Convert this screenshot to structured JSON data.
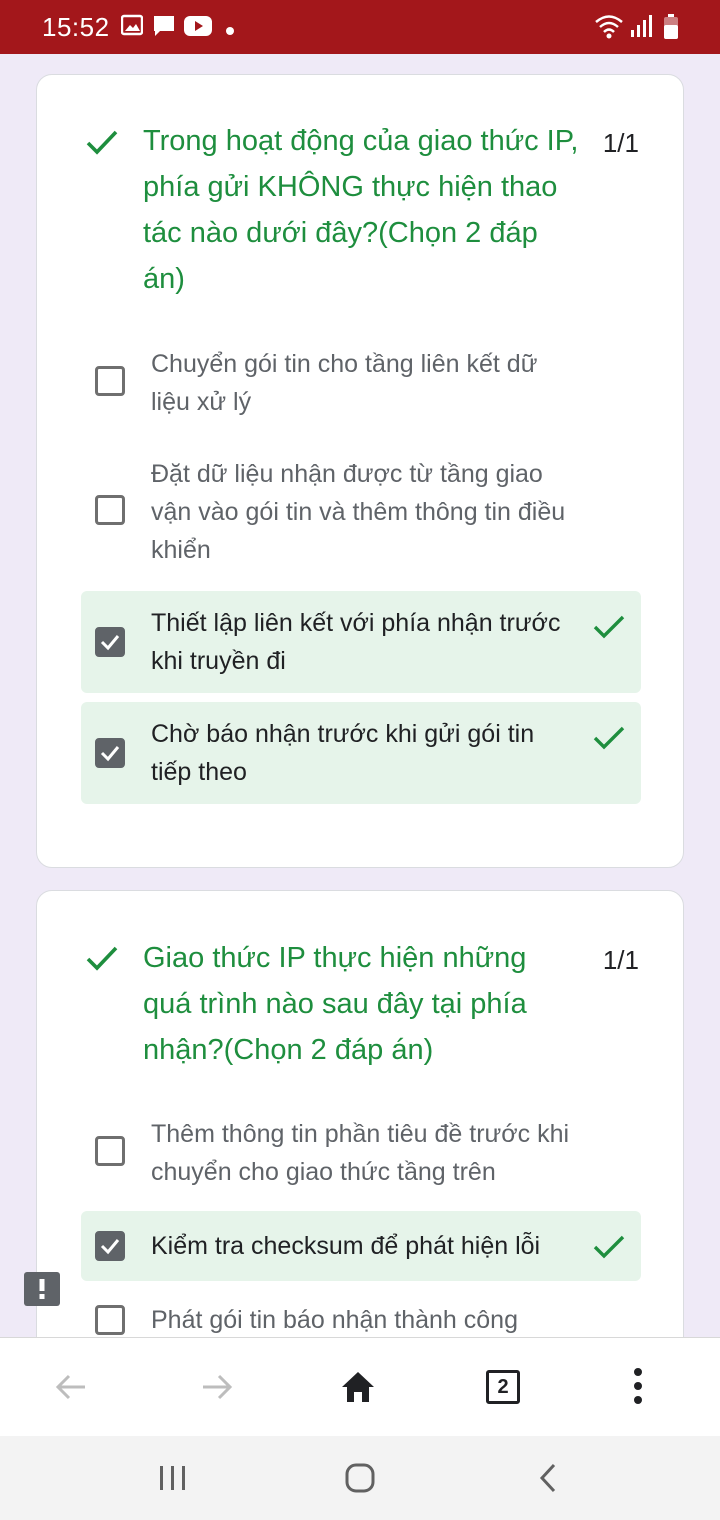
{
  "status_bar": {
    "time": "15:52",
    "icons": [
      "gallery-icon",
      "chat-icon",
      "youtube-icon",
      "dot-icon",
      "wifi-icon",
      "signal-icon",
      "battery-icon"
    ]
  },
  "questions": [
    {
      "title": "Trong hoạt động của giao thức IP, phía gửi KHÔNG thực hiện thao tác nào dưới đây?(Chọn 2 đáp án)",
      "score": "1/1",
      "options": [
        {
          "text": "Chuyển gói tin cho tầng liên kết dữ liệu xử lý",
          "checked": false
        },
        {
          "text": "Đặt dữ liệu nhận được từ tầng giao vận vào gói tin và thêm thông tin điều khiển",
          "checked": false
        },
        {
          "text": "Thiết lập liên kết với phía nhận trước khi truyền đi",
          "checked": true
        },
        {
          "text": "Chờ báo nhận trước khi gửi gói tin tiếp theo",
          "checked": true
        }
      ]
    },
    {
      "title": "Giao thức IP thực hiện những quá trình nào sau đây tại phía nhận?(Chọn 2 đáp án)",
      "score": "1/1",
      "options": [
        {
          "text": "Thêm thông tin phần tiêu đề trước khi chuyển cho giao thức tầng trên",
          "checked": false
        },
        {
          "text": "Kiểm tra checksum để phát hiện lỗi",
          "checked": true
        },
        {
          "text": "Phát gói tin báo nhận thành công",
          "checked": false
        }
      ]
    }
  ],
  "browser_toolbar": {
    "tab_count": "2"
  },
  "colors": {
    "status_bar": "#a3171b",
    "correct_green": "#1e8e3e",
    "selected_bg": "#e6f4ea",
    "page_bg": "#efeaf7"
  }
}
